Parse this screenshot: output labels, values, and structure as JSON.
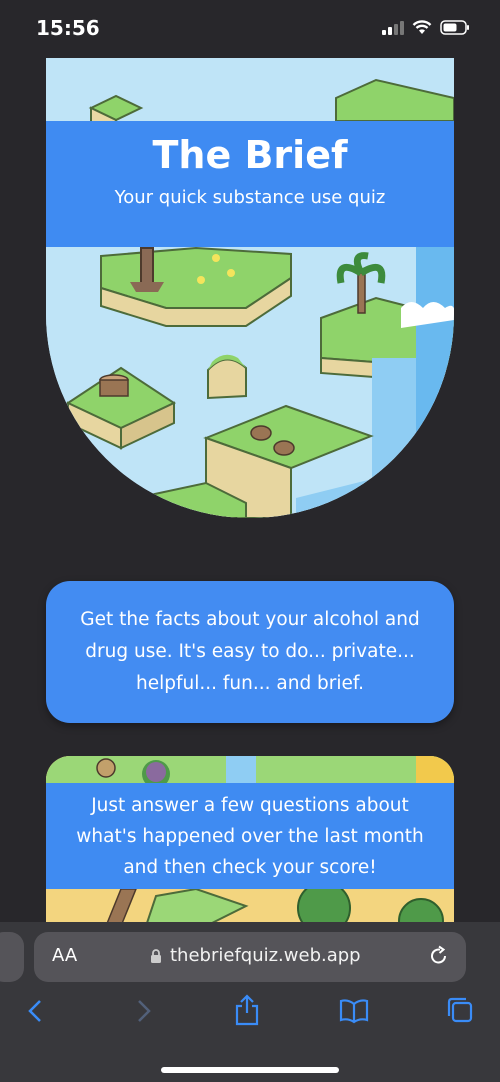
{
  "status_bar": {
    "time": "15:56"
  },
  "hero": {
    "title": "The Brief",
    "subtitle": "Your quick substance use quiz"
  },
  "intro_card": {
    "text": "Get the facts about your alcohol and drug use. It's easy to do... private... helpful... fun... and brief."
  },
  "second_card": {
    "text": "Just answer a few questions about what's happened over the last month and then check your score!"
  },
  "browser": {
    "text_size_label": "AA",
    "url": "thebriefquiz.web.app",
    "icons": [
      "lock-icon",
      "reload-icon",
      "back-icon",
      "forward-icon",
      "share-icon",
      "bookmarks-icon",
      "tabs-icon"
    ]
  },
  "colors": {
    "accent": "#3f8bf2",
    "background": "#28272b",
    "browser_chrome": "#38383c"
  }
}
